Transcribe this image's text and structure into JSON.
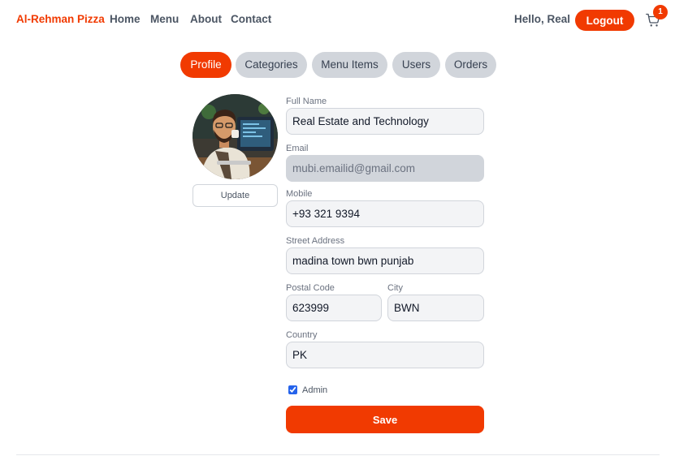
{
  "header": {
    "brand": "Al-Rehman Pizza",
    "nav": [
      "Home",
      "Menu",
      "About",
      "Contact"
    ],
    "greeting": "Hello, Real",
    "logout_label": "Logout",
    "cart_count": "1",
    "cart_icon": "cart-icon"
  },
  "tabs": [
    "Profile",
    "Categories",
    "Menu Items",
    "Users",
    "Orders"
  ],
  "active_tab": "Profile",
  "profile": {
    "update_label": "Update",
    "fields": {
      "full_name": {
        "label": "Full Name",
        "value": "Real Estate and Technology"
      },
      "email": {
        "label": "Email",
        "value": "mubi.emailid@gmail.com"
      },
      "mobile": {
        "label": "Mobile",
        "value": "+93 321 9394"
      },
      "street": {
        "label": "Street Address",
        "value": "madina town bwn punjab"
      },
      "postal": {
        "label": "Postal Code",
        "value": "623999"
      },
      "city": {
        "label": "City",
        "value": "BWN"
      },
      "country": {
        "label": "Country",
        "value": "PK"
      }
    },
    "admin_label": "Admin",
    "admin_checked": true,
    "save_label": "Save"
  },
  "colors": {
    "accent": "#f13a01",
    "tab_inactive": "#d1d5db",
    "field_bg": "#f3f4f6"
  }
}
